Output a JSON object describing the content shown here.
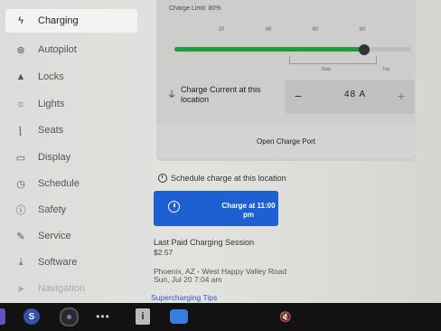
{
  "sidebar": {
    "items": [
      {
        "label": "Charging",
        "icon": "bolt-icon"
      },
      {
        "label": "Autopilot",
        "icon": "steering-wheel-icon"
      },
      {
        "label": "Locks",
        "icon": "lock-icon"
      },
      {
        "label": "Lights",
        "icon": "sun-icon"
      },
      {
        "label": "Seats",
        "icon": "seat-icon"
      },
      {
        "label": "Display",
        "icon": "display-icon"
      },
      {
        "label": "Schedule",
        "icon": "alarm-clock-icon"
      },
      {
        "label": "Safety",
        "icon": "info-circle-icon"
      },
      {
        "label": "Service",
        "icon": "wrench-icon"
      },
      {
        "label": "Software",
        "icon": "download-icon"
      },
      {
        "label": "Navigation",
        "icon": "navigation-arrow-icon"
      }
    ],
    "active": "Charging"
  },
  "charge_limit": {
    "label": "Charge Limit: 80%",
    "value_percent": 80,
    "ticks": [
      "20",
      "40",
      "60",
      "80"
    ],
    "range_labels": {
      "daily": "Daily",
      "trip": "Trip"
    },
    "fill_color": "#1f9a3c"
  },
  "charge_current": {
    "label": "Charge Current at this location",
    "value": "48 A",
    "minus": "−",
    "plus": "+"
  },
  "charge_port": {
    "label": "Open Charge Port"
  },
  "schedule": {
    "label": "Schedule charge at this location"
  },
  "charge_button": {
    "label": "Charge at 11:00 pm",
    "color": "#1e5fd1"
  },
  "last_session": {
    "title": "Last Paid Charging Session",
    "price": "$2.57",
    "location": "Phoenix, AZ - West Happy Valley Road",
    "time": "Sun, Jul 20 7:04 am"
  },
  "tips_link": "Supercharging Tips",
  "taskbar": {
    "s_label": "S",
    "dots": "•••",
    "info": "i",
    "volume": "🔇"
  }
}
